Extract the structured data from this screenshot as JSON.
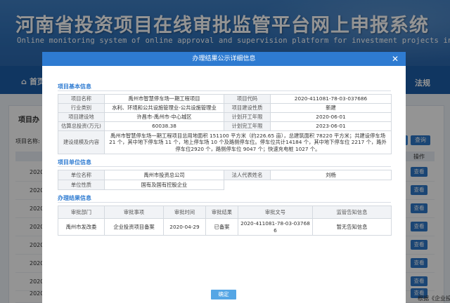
{
  "site": {
    "title": "河南省投资项目在线审批监管平台网上申报系统",
    "subtitle": "Online monitoring system of online approval and supervision platform for investment projects in Henan",
    "nav_home": "首页",
    "nav_right": "法规",
    "list_title": "项目办",
    "filter_label": "项目名称:",
    "query_button": "查询",
    "op_column": "操作",
    "rows": [
      {
        "year": "2020",
        "button": "查看"
      },
      {
        "year": "2020",
        "button": "查看"
      },
      {
        "year": "2020",
        "button": "查看"
      },
      {
        "year": "2020",
        "button": "查看"
      },
      {
        "year": "2020",
        "button": "查看"
      },
      {
        "year": "2020",
        "button": "查看"
      },
      {
        "year": "2020",
        "button": "查看"
      },
      {
        "year": "2020",
        "button": "查看"
      }
    ],
    "footer_note": "根据《企业投"
  },
  "modal": {
    "title": "办理结果公示详细信息",
    "close_icon": "close-icon",
    "ok_button": "确定",
    "basic": {
      "section_title": "项目基本信息",
      "project_name_label": "项目名称",
      "project_name": "禹州市智慧停车场一期工程项目",
      "project_code_label": "项目代码",
      "project_code": "2020-411081-78-03-037686",
      "industry_label": "行业类别",
      "industry": "水利、环境和公共设施管理业-公共设施管理业",
      "build_nature_label": "项目建设性质",
      "build_nature": "新建",
      "location_label": "项目建设地",
      "location": "许昌市-禹州市-中心城区",
      "start_label": "计划开工年限",
      "start": "2020-06-01",
      "investment_label": "估算总投资(万元)",
      "investment": "60038.38",
      "finish_label": "计划完工年限",
      "finish": "2023-06-01",
      "scope_label": "建设规模及内容",
      "scope": "禹州市智慧停车场一期工程项目总用地面积 151100 平方米（约226.65 亩），总建筑面积 78220 平方米；共建设停车场 21 个，其中地下停车场 11 个，地上停车场 10 个及路侧停车位。停车位共计14184 个，其中地下停车位 2217 个，路外停车位2920 个，路侧停车位 9047 个；快速充电桩 1027 个。"
    },
    "unit": {
      "section_title": "项目单位信息",
      "unit_name_label": "单位名称",
      "unit_name": "禹州市投资总公司",
      "legal_rep_label": "法人代表姓名",
      "legal_rep": "刘杨",
      "unit_nature_label": "单位性质",
      "unit_nature": "国有及国有控股企业"
    },
    "result": {
      "section_title": "办理结果信息",
      "headers": [
        "审批部门",
        "审批事项",
        "审批时间",
        "审批结果",
        "审批文号",
        "监管告知信息"
      ],
      "rows": [
        [
          "禹州市发改委",
          "企业投资项目备案",
          "2020-04-29",
          "已备案",
          "2020-411081-78-03-037686",
          "暂无告知信息"
        ]
      ]
    }
  }
}
